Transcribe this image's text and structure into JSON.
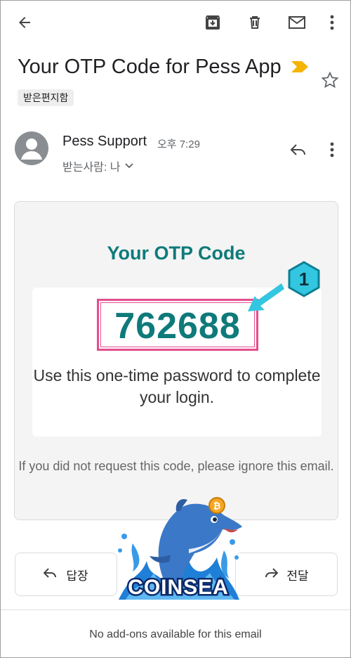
{
  "toolbar": {
    "back_icon": "arrow-left-icon",
    "archive_icon": "archive-icon",
    "delete_icon": "trash-icon",
    "mark_unread_icon": "mail-icon",
    "more_icon": "more-vert-icon"
  },
  "email": {
    "subject": "Your OTP Code for Pess App",
    "label": "받은편지함",
    "sender_name": "Pess Support",
    "time": "오후 7:29",
    "recipient": "받는사람: 나"
  },
  "content": {
    "heading": "Your OTP Code",
    "otp_code": "762688",
    "instruction": "Use this one-time password to complete your login.",
    "ignore_note": "If you did not request this code, please ignore this email."
  },
  "annotation": {
    "badge_number": "1",
    "color": "#33c6e0"
  },
  "actions": {
    "reply_label": "답장",
    "forward_label": "전달"
  },
  "addons_text": "No add-ons available for this email",
  "watermark": {
    "text": "COINSEA"
  },
  "colors": {
    "accent_teal": "#0f7a7a",
    "highlight_pink": "#e44d8f",
    "importance_yellow": "#f5b400"
  }
}
